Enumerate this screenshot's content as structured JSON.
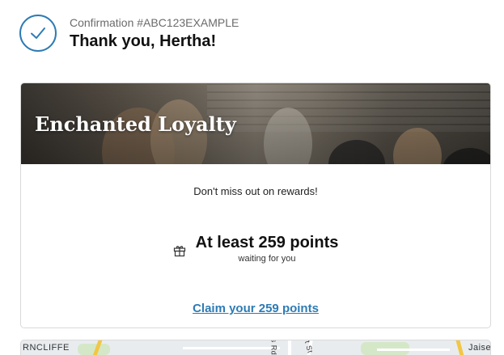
{
  "header": {
    "confirmation": "Confirmation #ABC123EXAMPLE",
    "thanks": "Thank you, Hertha!",
    "check_icon": "checkmark-icon"
  },
  "loyalty": {
    "banner_title": "Enchanted Loyalty",
    "subtitle": "Don't miss out on rewards!",
    "points_title": "At least 259 points",
    "points_sub": "waiting for you",
    "gift_icon": "gift-icon",
    "claim_label": "Claim your 259 points"
  },
  "map": {
    "label_left": "RNCLIFFE",
    "label_right": "Jaise",
    "street_a": "s Rd",
    "street_b": "t St"
  },
  "colors": {
    "accent": "#2d7bb5",
    "border": "#d9d9d9"
  }
}
